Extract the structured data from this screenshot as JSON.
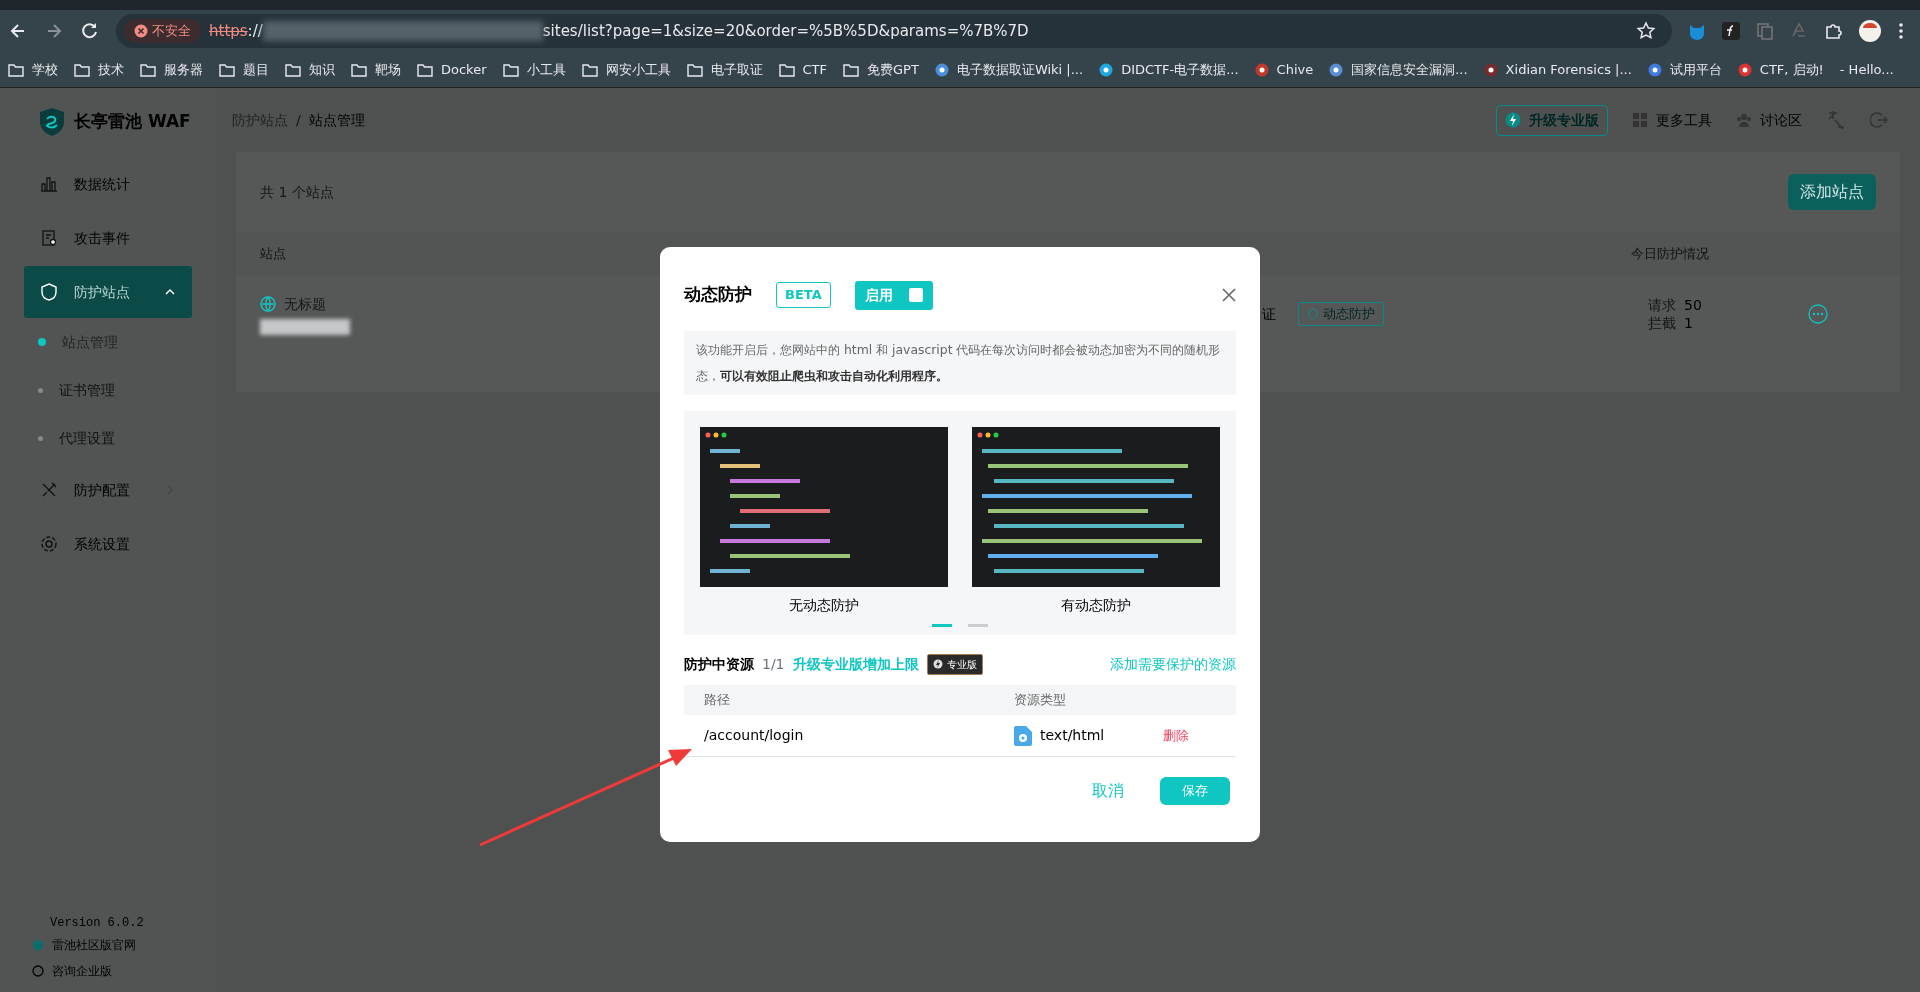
{
  "browser": {
    "security_label": "不安全",
    "url_scheme": "https",
    "url_separator": "://",
    "url_rest": "sites/list?page=1&size=20&order=%5B%5D&params=%7B%7D",
    "bookmarks": [
      {
        "label": "学校",
        "kind": "folder"
      },
      {
        "label": "技术",
        "kind": "folder"
      },
      {
        "label": "服务器",
        "kind": "folder"
      },
      {
        "label": "题目",
        "kind": "folder"
      },
      {
        "label": "知识",
        "kind": "folder"
      },
      {
        "label": "靶场",
        "kind": "folder"
      },
      {
        "label": "Docker",
        "kind": "folder"
      },
      {
        "label": "小工具",
        "kind": "folder"
      },
      {
        "label": "网安小工具",
        "kind": "folder"
      },
      {
        "label": "电子取证",
        "kind": "folder"
      },
      {
        "label": "CTF",
        "kind": "folder"
      },
      {
        "label": "免费GPT",
        "kind": "folder"
      },
      {
        "label": "电子数据取证Wiki |...",
        "kind": "site"
      },
      {
        "label": "DIDCTF-电子数据...",
        "kind": "site"
      },
      {
        "label": "Chive",
        "kind": "site"
      },
      {
        "label": "国家信息安全漏洞...",
        "kind": "site"
      },
      {
        "label": "Xidian Forensics |...",
        "kind": "site"
      },
      {
        "label": "试用平台",
        "kind": "site"
      },
      {
        "label": "CTF, 启动!",
        "kind": "site"
      },
      {
        "label": "- Hello...",
        "kind": "text"
      }
    ]
  },
  "app": {
    "logo": "长亭雷池 WAF",
    "breadcrumb_separator": "/",
    "breadcrumb": [
      {
        "label": "防护站点",
        "selected": false
      },
      {
        "label": "站点管理",
        "selected": true
      }
    ],
    "header_actions": [
      {
        "label": "升级专业版",
        "kind": "upgrade"
      },
      {
        "label": "更多工具",
        "kind": "plain"
      },
      {
        "label": "讨论区",
        "kind": "plain"
      }
    ],
    "sidebar": {
      "items": [
        {
          "label": "数据统计",
          "selected": false
        },
        {
          "label": "攻击事件",
          "selected": false
        },
        {
          "label": "防护站点",
          "selected": true,
          "expanded": true,
          "children": [
            {
              "label": "站点管理",
              "selected": true
            },
            {
              "label": "证书管理",
              "selected": false
            },
            {
              "label": "代理设置",
              "selected": false
            }
          ]
        },
        {
          "label": "防护配置",
          "selected": false,
          "expanded": false
        },
        {
          "label": "系统设置",
          "selected": false
        }
      ],
      "version": "Version 6.0.2",
      "links": [
        "雷池社区版官网",
        "咨询企业版"
      ]
    },
    "content": {
      "count_text": "共 1 个站点",
      "add_button": "添加站点",
      "columns": [
        "站点",
        "今日防护情况"
      ],
      "rows": [
        {
          "name": "无标题",
          "cut_text": "证",
          "badge": "动态防护",
          "stats": [
            {
              "label": "请求",
              "value": "50"
            },
            {
              "label": "拦截",
              "value": "1"
            }
          ]
        }
      ]
    }
  },
  "modal": {
    "title": "动态防护",
    "beta": "BETA",
    "toggle": {
      "label": "启用",
      "on": true
    },
    "description": "该功能开启后，您网站中的 html 和 javascript 代码在每次访问时都会被动态加密为不同的随机形态，**可以有效阻止爬虫和攻击自动化利用程序。**",
    "slides": [
      {
        "caption": "无动态防护",
        "kind": "picture"
      },
      {
        "caption": "有动态防护",
        "kind": "picture"
      }
    ],
    "carousel_dots": [
      {
        "selected": true
      },
      {
        "selected": false
      }
    ],
    "resources": {
      "title": "防护中资源",
      "count": "1/1",
      "upgrade_link": "升级专业版增加上限",
      "pro_badge": "专业版",
      "add_link": "添加需要保护的资源",
      "columns": [
        "路径",
        "资源类型"
      ],
      "rows": [
        {
          "path": "/account/login",
          "type": "text/html",
          "action": "删除"
        }
      ]
    },
    "cancel": "取消",
    "save": "保存"
  }
}
